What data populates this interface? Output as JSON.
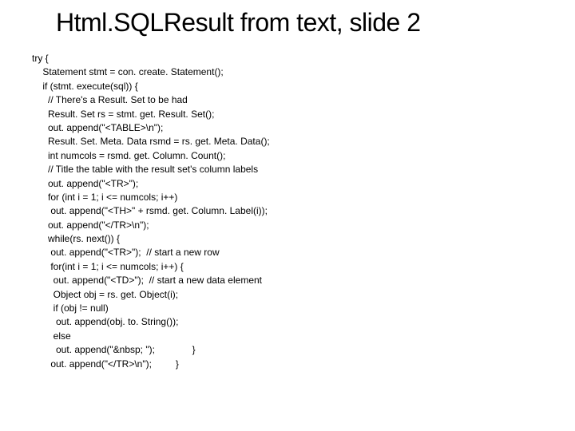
{
  "slide": {
    "title": "Html.SQLResult from text, slide 2",
    "code": "try {\n    Statement stmt = con. create. Statement();\n    if (stmt. execute(sql)) {\n      // There's a Result. Set to be had\n      Result. Set rs = stmt. get. Result. Set();\n      out. append(\"<TABLE>\\n\");\n      Result. Set. Meta. Data rsmd = rs. get. Meta. Data();\n      int numcols = rsmd. get. Column. Count();\n      // Title the table with the result set's column labels\n      out. append(\"<TR>\");\n      for (int i = 1; i <= numcols; i++)\n       out. append(\"<TH>\" + rsmd. get. Column. Label(i));\n      out. append(\"</TR>\\n\");\n      while(rs. next()) {\n       out. append(\"<TR>\");  // start a new row\n       for(int i = 1; i <= numcols; i++) {\n        out. append(\"<TD>\");  // start a new data element\n        Object obj = rs. get. Object(i);\n        if (obj != null)\n         out. append(obj. to. String());\n        else\n         out. append(\"&nbsp; \");              }\n       out. append(\"</TR>\\n\");         }"
  }
}
